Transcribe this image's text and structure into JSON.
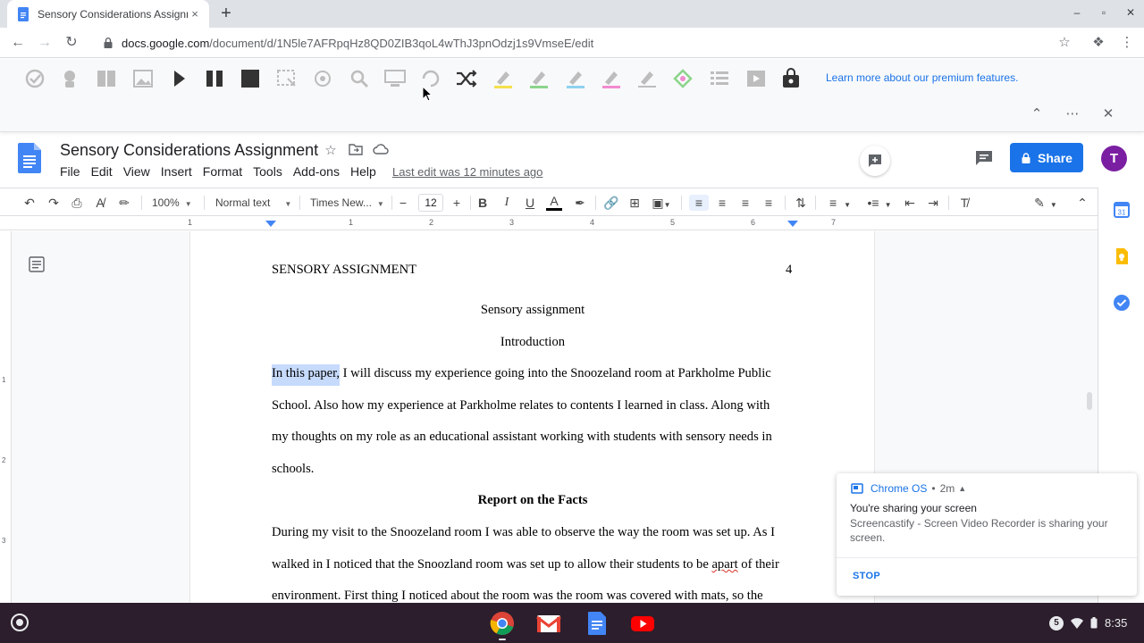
{
  "browser": {
    "tab_title": "Sensory Considerations Assignm",
    "tab_close": "×",
    "new_tab": "+",
    "url_host": "docs.google.com",
    "url_path": "/document/d/1N5le7AFRpqHz8QD0ZIB3qoL4wThJ3pnOdzj1s9VmseE/edit",
    "window_controls": [
      "–",
      "▫",
      "✕"
    ]
  },
  "extension_bar": {
    "learn_more": "Learn more about our premium features.",
    "icons": [
      "check-it-icon",
      "voice-note-icon",
      "dictionary-icon",
      "picture-dictionary-icon",
      "play-icon",
      "pause-icon",
      "stop-icon",
      "screenshot-reader-icon",
      "audio-maker-icon",
      "speech-input-icon",
      "simplify-icon",
      "rewordify-icon",
      "shuffle-icon",
      "highlight-yellow-icon",
      "highlight-green-icon",
      "highlight-blue-icon",
      "highlight-pink-icon",
      "clear-highlights-icon",
      "collect-highlights-icon",
      "vocabulary-icon",
      "web-search-icon",
      "premium-icon"
    ]
  },
  "docs": {
    "title": "Sensory Considerations Assignment",
    "menu": [
      "File",
      "Edit",
      "View",
      "Insert",
      "Format",
      "Tools",
      "Add-ons",
      "Help"
    ],
    "last_edit": "Last edit was 12 minutes ago",
    "share_label": "Share",
    "avatar_letter": "T",
    "toolbar": {
      "zoom": "100%",
      "style": "Normal text",
      "font": "Times New...",
      "font_size": "12"
    },
    "ruler_labels": [
      "1",
      "1",
      "2",
      "3",
      "4",
      "5",
      "6",
      "7"
    ],
    "vruler_labels": [
      "1",
      "2",
      "3"
    ],
    "page": {
      "header_left": "SENSORY ASSIGNMENT",
      "header_right": "4",
      "title": "Sensory assignment",
      "intro_heading": "Introduction",
      "para1_highlight": "In this paper,",
      "para1_line1_rest": " I will discuss my experience going into the Snoozeland room at Parkholme Public",
      "para1_line2": "School. Also how my experience at Parkholme relates to contents I learned in class. Along with",
      "para1_line3": "my thoughts on my role  as an educational assistant working with students with sensory needs in",
      "para1_line4": "schools.",
      "report_heading": "Report on the Facts",
      "para2_line1": "During my visit to the Snoozeland room I was able to observe the way the room was set up. As I",
      "para2_line2_a": "walked in I noticed that the Snoozland room was set up to allow their students to be ",
      "para2_line2_spell": "apart",
      "para2_line2_b": " of their",
      "para2_line3": "environment. First thing I noticed about the room was the room was covered with mats, so the"
    }
  },
  "notification": {
    "source": "Chrome OS",
    "separator": "•",
    "time": "2m",
    "title": "You're sharing your screen",
    "body": "Screencastify - Screen Video Recorder is sharing your screen.",
    "action": "STOP"
  },
  "shelf": {
    "apps": [
      "chrome-icon",
      "gmail-icon",
      "docs-icon",
      "youtube-icon"
    ],
    "tray_badge": "5",
    "clock": "8:35"
  },
  "colors": {
    "accent": "#1a73e8",
    "avatar": "#7b1fa2",
    "shelf": "#2c1e2c",
    "selection": "#c6dafc"
  }
}
